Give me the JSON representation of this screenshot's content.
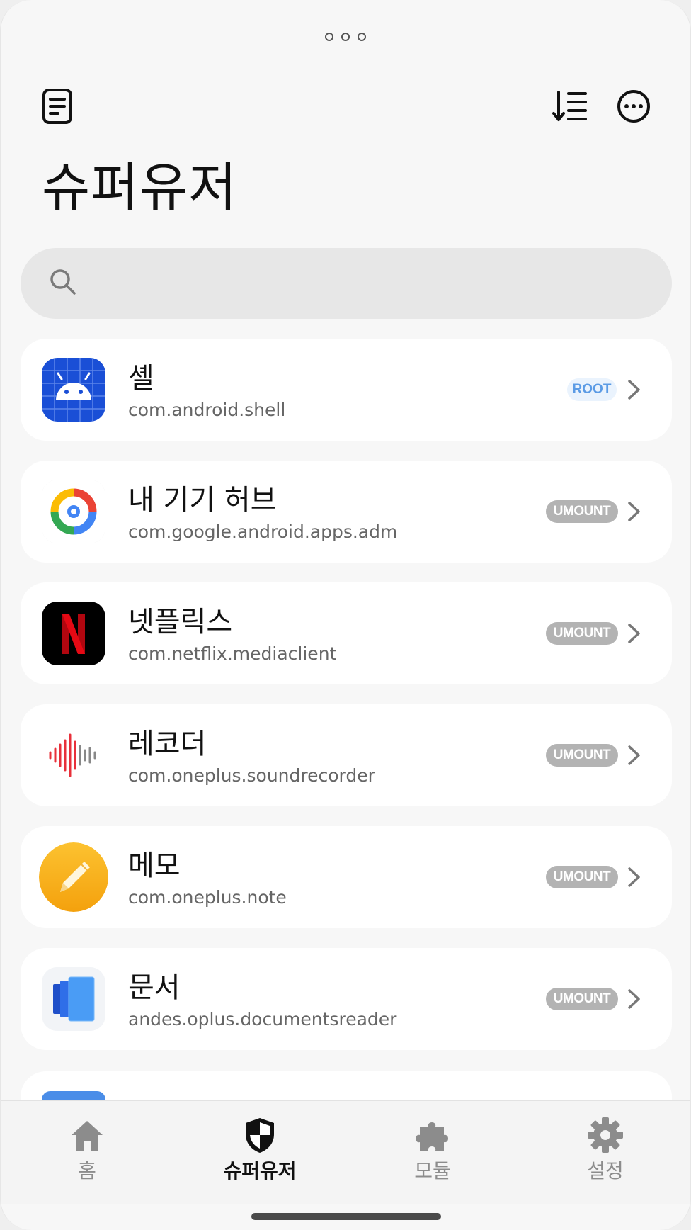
{
  "header": {
    "title": "슈퍼유저",
    "search_placeholder": ""
  },
  "icons": {
    "top_left": "document-icon",
    "sort": "sort-icon",
    "more": "more-icon",
    "search": "search-icon"
  },
  "apps": [
    {
      "name": "셸",
      "package": "com.android.shell",
      "badge": "ROOT",
      "badge_type": "root",
      "icon": "android-shell-icon"
    },
    {
      "name": "내 기기 허브",
      "package": "com.google.android.apps.adm",
      "badge": "UMOUNT",
      "badge_type": "umount",
      "icon": "device-hub-icon"
    },
    {
      "name": "넷플릭스",
      "package": "com.netflix.mediaclient",
      "badge": "UMOUNT",
      "badge_type": "umount",
      "icon": "netflix-icon"
    },
    {
      "name": "레코더",
      "package": "com.oneplus.soundrecorder",
      "badge": "UMOUNT",
      "badge_type": "umount",
      "icon": "recorder-icon"
    },
    {
      "name": "메모",
      "package": "com.oneplus.note",
      "badge": "UMOUNT",
      "badge_type": "umount",
      "icon": "memo-icon"
    },
    {
      "name": "문서",
      "package": "andes.oplus.documentsreader",
      "badge": "UMOUNT",
      "badge_type": "umount",
      "icon": "documents-icon"
    }
  ],
  "nav": {
    "items": [
      {
        "label": "홈",
        "icon": "home-icon",
        "active": false
      },
      {
        "label": "슈퍼유저",
        "icon": "shield-icon",
        "active": true
      },
      {
        "label": "모듈",
        "icon": "puzzle-icon",
        "active": false
      },
      {
        "label": "설정",
        "icon": "gear-icon",
        "active": false
      }
    ]
  },
  "colors": {
    "background": "#f7f7f7",
    "card": "#ffffff",
    "root_badge_bg": "#eaf3fd",
    "root_badge_text": "#5b9be5",
    "umount_badge_bg": "#b3b3b3",
    "netflix_red": "#e50914"
  }
}
